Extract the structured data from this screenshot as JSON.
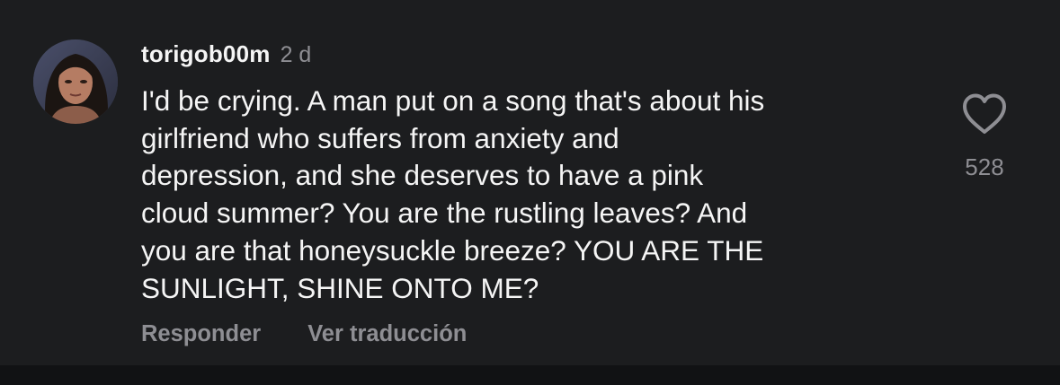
{
  "comment": {
    "username": "torigob00m",
    "timestamp": "2 d",
    "avatar_icon": "profile-photo",
    "text_lines": [
      "I'd be crying. A man put on a song that's about his",
      "girlfriend who suffers from anxiety and",
      "depression, and she deserves to have a pink",
      "cloud summer? You are the rustling leaves? And",
      "you are that honeysuckle breeze? YOU ARE THE",
      "SUNLIGHT, SHINE ONTO ME?"
    ],
    "like_icon": "heart-outline-icon",
    "like_count": "528"
  },
  "actions": {
    "reply_label": "Responder",
    "translate_label": "Ver traducción"
  },
  "colors": {
    "background": "#1c1d1f",
    "primary_text": "#f5f5f5",
    "secondary_text": "#8e8e93"
  }
}
